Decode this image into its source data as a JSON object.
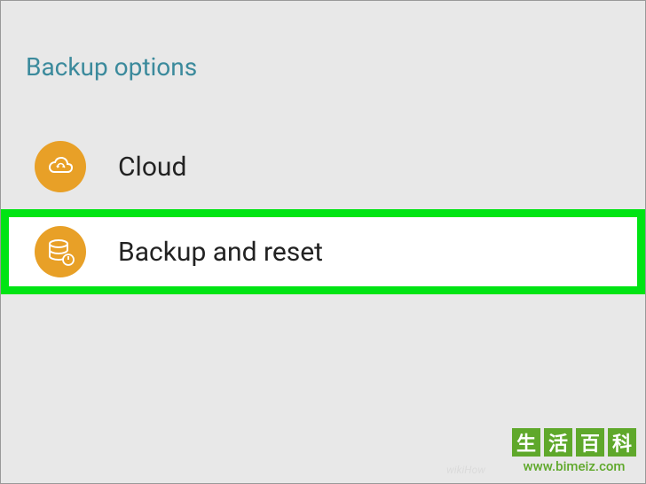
{
  "section": {
    "title": "Backup options"
  },
  "menu": {
    "items": [
      {
        "id": "cloud",
        "label": "Cloud",
        "icon": "cloud-sync-icon",
        "highlighted": false
      },
      {
        "id": "backup-reset",
        "label": "Backup and reset",
        "icon": "database-power-icon",
        "highlighted": true
      }
    ]
  },
  "watermark": {
    "chars": [
      "生",
      "活",
      "百",
      "科"
    ],
    "url": "www.bimeiz.com"
  },
  "colors": {
    "accent_teal": "#3b8a9c",
    "icon_bg": "#e8a027",
    "highlight": "#00e413",
    "watermark_green": "#5fa82b"
  }
}
